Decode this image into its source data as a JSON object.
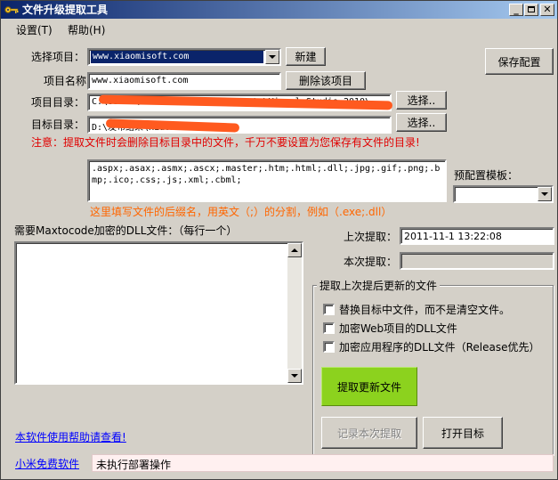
{
  "window": {
    "title": "文件升级提取工具"
  },
  "menu": {
    "settings": "设置(T)",
    "help": "帮助(H)"
  },
  "labels": {
    "select_project": "选择项目：",
    "project_name": "项目名称：",
    "project_dir": "项目目录：",
    "target_dir": "目标目录：",
    "preset_template": "预配置模板：",
    "dll_list": "需要Maxtocode加密的DLL文件：（每行一个）",
    "last_extract": "上次提取：",
    "this_extract": "本次提取："
  },
  "fields": {
    "select_project_value": "www.xiaomisoft.com",
    "project_name_value": "www.xiaomisoft.com",
    "project_dir_value": "C:\\Users\\Administrator\\Documents\\Visual Studio 2010\\",
    "target_dir_value": "D:\\发布结果\\xiaomisoft",
    "extensions_value": ".aspx;.asax;.asmx;.ascx;.master;.htm;.html;.dll;.jpg;.gif;.png;.bmp;.ico;.css;.js;.xml;.cbml;",
    "last_extract_value": "2011-11-1 13:22:08",
    "this_extract_value": "",
    "status_value": "未执行部署操作"
  },
  "buttons": {
    "new": "新建",
    "delete_project": "删除该项目",
    "browse1": "选择..",
    "browse2": "选择..",
    "save_config": "保存配置",
    "extract": "提取更新文件",
    "record": "记录本次提取",
    "open_target": "打开目标"
  },
  "notes": {
    "warning": "注意：提取文件时会删除目标目录中的文件，千万不要设置为您保存有文件的目录!",
    "extension_hint": "这里填写文件的后缀名，用英文（;）的分割，例如（.exe;.dll）"
  },
  "group": {
    "title": "提取上次提后更新的文件",
    "options": [
      "替换目标中文件，而不是清空文件。",
      "加密Web项目的DLL文件",
      "加密应用程序的DLL文件（Release优先）"
    ]
  },
  "links": {
    "help": "本软件使用帮助请查看!",
    "free": "小米免费软件"
  },
  "colors": {
    "accent_green": "#8cd21e",
    "warning_red": "#e00000",
    "hint_orange": "#ff6600",
    "link_blue": "#0000ff"
  }
}
